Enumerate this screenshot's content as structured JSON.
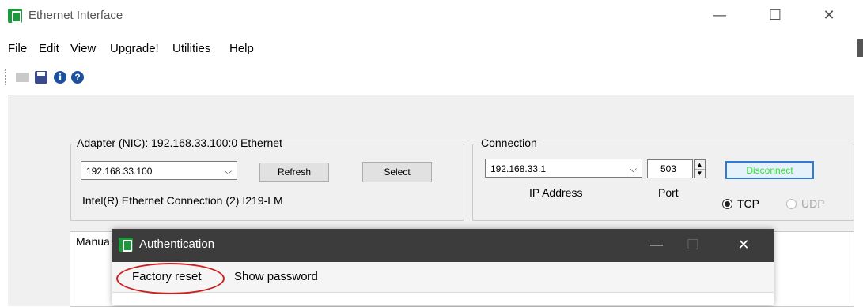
{
  "window": {
    "title": "Ethernet Interface",
    "controls": {
      "minimize": "—",
      "maximize": "☐",
      "close": "✕"
    }
  },
  "menu": [
    "File",
    "Edit",
    "View",
    "Upgrade!",
    "Utilities",
    "Help"
  ],
  "toolbar": {
    "icons": [
      "open-folder-icon",
      "save-icon",
      "info-icon",
      "help-icon"
    ]
  },
  "adapter": {
    "group_label": "Adapter (NIC): 192.168.33.100:0 Ethernet",
    "selected_ip": "192.168.33.100",
    "refresh_label": "Refresh",
    "select_label": "Select",
    "description": "Intel(R) Ethernet Connection (2) I219-LM"
  },
  "connection": {
    "group_label": "Connection",
    "ip": "192.168.33.1",
    "ip_label": "IP Address",
    "port": "503",
    "port_label": "Port",
    "disconnect_label": "Disconnect",
    "disconnect_color": "#36e03a",
    "tcp_label": "TCP",
    "udp_label": "UDP",
    "protocol_selected": "TCP"
  },
  "tabs": [
    "Manua"
  ],
  "auth_dialog": {
    "title": "Authentication",
    "controls": {
      "minimize": "—",
      "maximize": "☐",
      "close": "✕"
    },
    "menu": [
      "Factory reset",
      "Show password"
    ],
    "highlight_color": "#cc1f1f"
  }
}
